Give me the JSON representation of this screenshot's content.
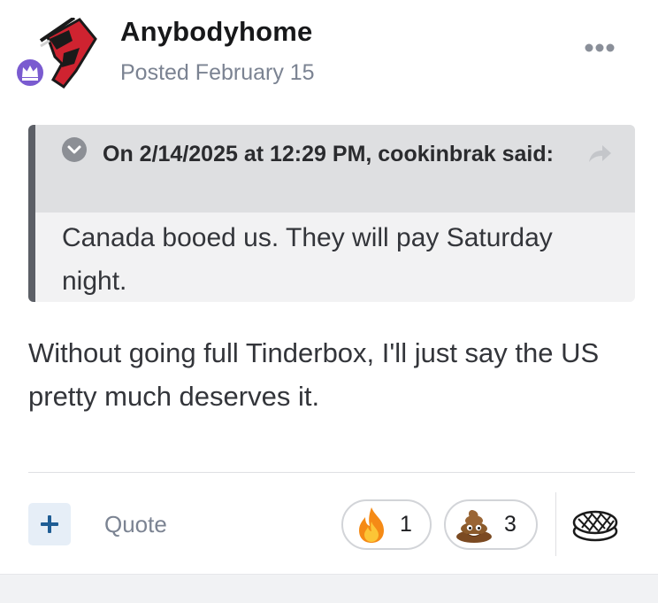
{
  "post": {
    "author": "Anybodyhome",
    "posted_label": "Posted",
    "posted_date": "February 15"
  },
  "quote": {
    "citation": "On 2/14/2025 at 12:29 PM, cookinbrak said:",
    "text": "Canada booed us. They will pay Saturday night."
  },
  "body": {
    "text": "Without going full Tinderbox, I'll just say the US pretty much deserves it."
  },
  "footer": {
    "quote_label": "Quote",
    "reactions": [
      {
        "icon": "fire-icon",
        "count": "1"
      },
      {
        "icon": "poop-icon",
        "count": "3"
      }
    ]
  },
  "icons": {
    "avatar": "hockey-logo-avatar",
    "badge": "crown-badge-icon",
    "menu": "more-dots-icon",
    "collapse": "chevron-down-circle-icon",
    "share": "share-arrow-icon",
    "add": "plus-icon",
    "reaction_picker": "pie-icon"
  },
  "colors": {
    "accent": "#2b6cb0",
    "badge": "#7a5bd0",
    "muted_text": "#7b8392",
    "quote_bar": "#5c5f66"
  }
}
